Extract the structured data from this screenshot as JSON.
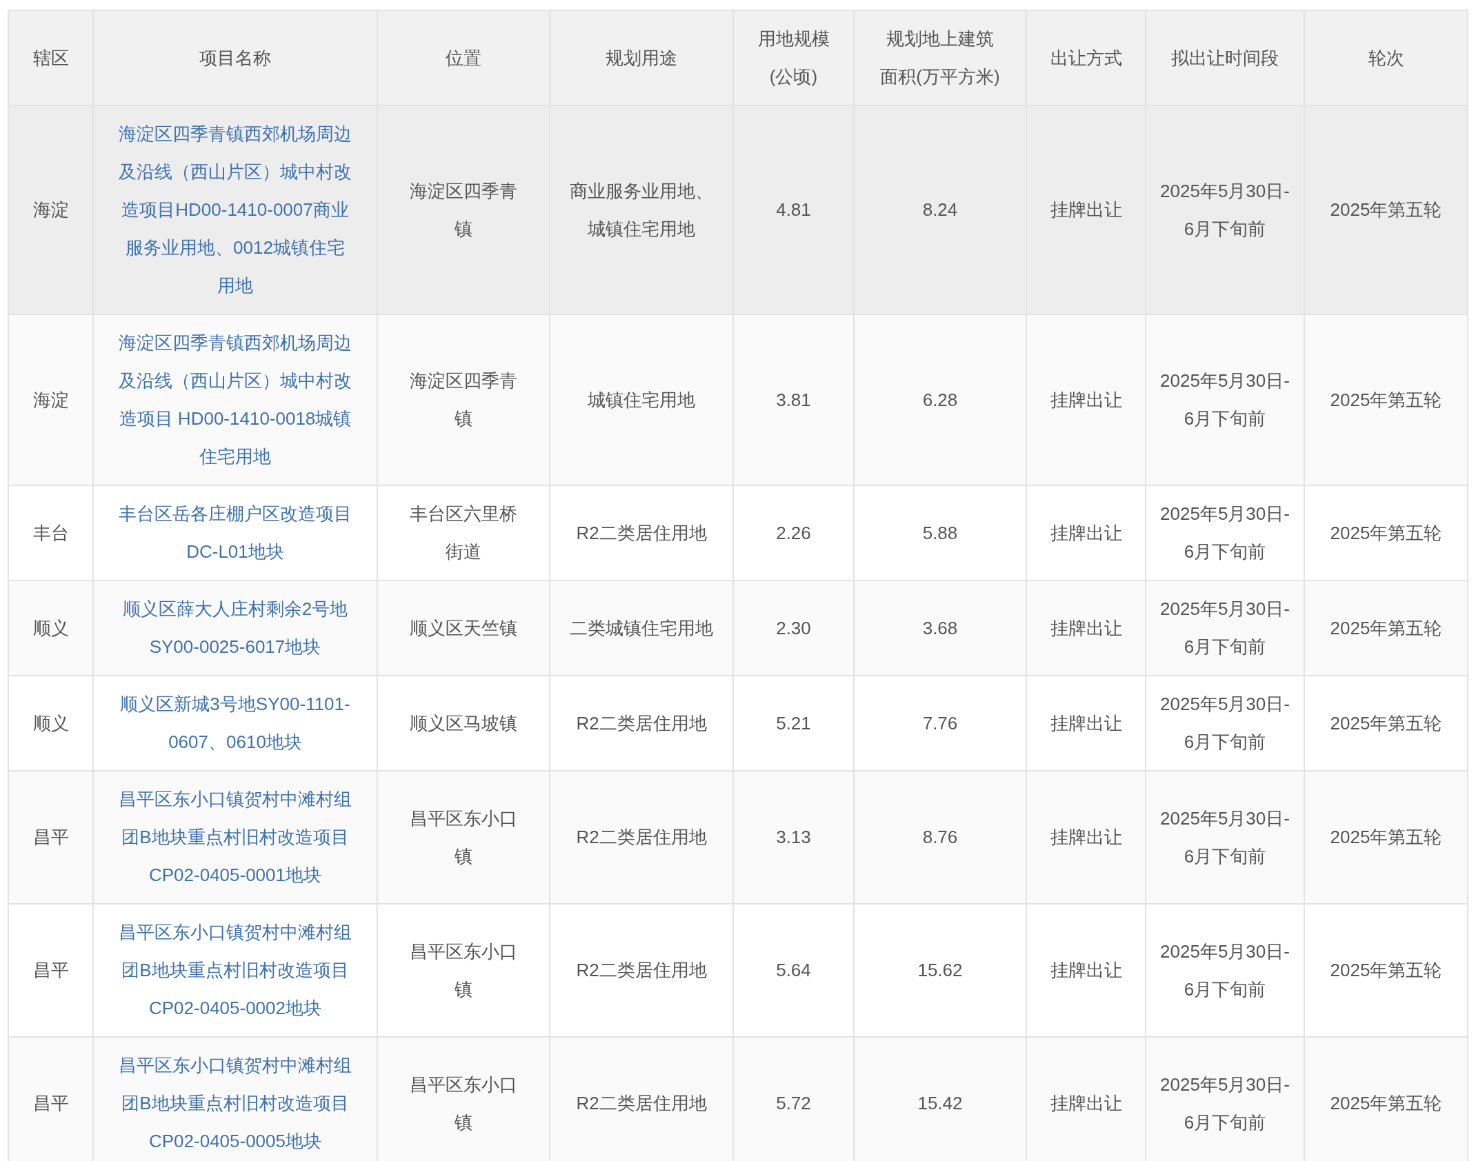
{
  "table": {
    "columns": [
      "辖区",
      "项目名称",
      "位置",
      "规划用途",
      "用地规模(公顷)",
      "规划地上建筑面积(万平方米)",
      "出让方式",
      "拟出让时间段",
      "轮次"
    ],
    "rows": [
      {
        "highlighted": true,
        "cells": [
          "海淀",
          "海淀区四季青镇西郊机场周边及沿线（西山片区）城中村改造项目HD00-1410-0007商业服务业用地、0012城镇住宅用地",
          "海淀区四季青镇",
          "商业服务业用地、城镇住宅用地",
          "4.81",
          "8.24",
          "挂牌出让",
          "2025年5月30日-6月下旬前",
          "2025年第五轮"
        ]
      },
      {
        "highlighted": false,
        "cells": [
          "海淀",
          "海淀区四季青镇西郊机场周边及沿线（西山片区）城中村改造项目 HD00-1410-0018城镇住宅用地",
          "海淀区四季青镇",
          "城镇住宅用地",
          "3.81",
          "6.28",
          "挂牌出让",
          "2025年5月30日-6月下旬前",
          "2025年第五轮"
        ]
      },
      {
        "highlighted": false,
        "cells": [
          "丰台",
          "丰台区岳各庄棚户区改造项目DC-L01地块",
          "丰台区六里桥街道",
          "R2二类居住用地",
          "2.26",
          "5.88",
          "挂牌出让",
          "2025年5月30日-6月下旬前",
          "2025年第五轮"
        ]
      },
      {
        "highlighted": false,
        "cells": [
          "顺义",
          "顺义区薛大人庄村剩余2号地SY00-0025-6017地块",
          "顺义区天竺镇",
          "二类城镇住宅用地",
          "2.30",
          "3.68",
          "挂牌出让",
          "2025年5月30日-6月下旬前",
          "2025年第五轮"
        ]
      },
      {
        "highlighted": false,
        "cells": [
          "顺义",
          "顺义区新城3号地SY00-1101-0607、0610地块",
          "顺义区马坡镇",
          "R2二类居住用地",
          "5.21",
          "7.76",
          "挂牌出让",
          "2025年5月30日-6月下旬前",
          "2025年第五轮"
        ]
      },
      {
        "highlighted": false,
        "cells": [
          "昌平",
          "昌平区东小口镇贺村中滩村组团B地块重点村旧村改造项目CP02-0405-0001地块",
          "昌平区东小口镇",
          "R2二类居住用地",
          "3.13",
          "8.76",
          "挂牌出让",
          "2025年5月30日-6月下旬前",
          "2025年第五轮"
        ]
      },
      {
        "highlighted": false,
        "cells": [
          "昌平",
          "昌平区东小口镇贺村中滩村组团B地块重点村旧村改造项目CP02-0405-0002地块",
          "昌平区东小口镇",
          "R2二类居住用地",
          "5.64",
          "15.62",
          "挂牌出让",
          "2025年5月30日-6月下旬前",
          "2025年第五轮"
        ]
      },
      {
        "highlighted": false,
        "cells": [
          "昌平",
          "昌平区东小口镇贺村中滩村组团B地块重点村旧村改造项目CP02-0405-0005地块",
          "昌平区东小口镇",
          "R2二类居住用地",
          "5.72",
          "15.42",
          "挂牌出让",
          "2025年5月30日-6月下旬前",
          "2025年第五轮"
        ]
      }
    ]
  }
}
